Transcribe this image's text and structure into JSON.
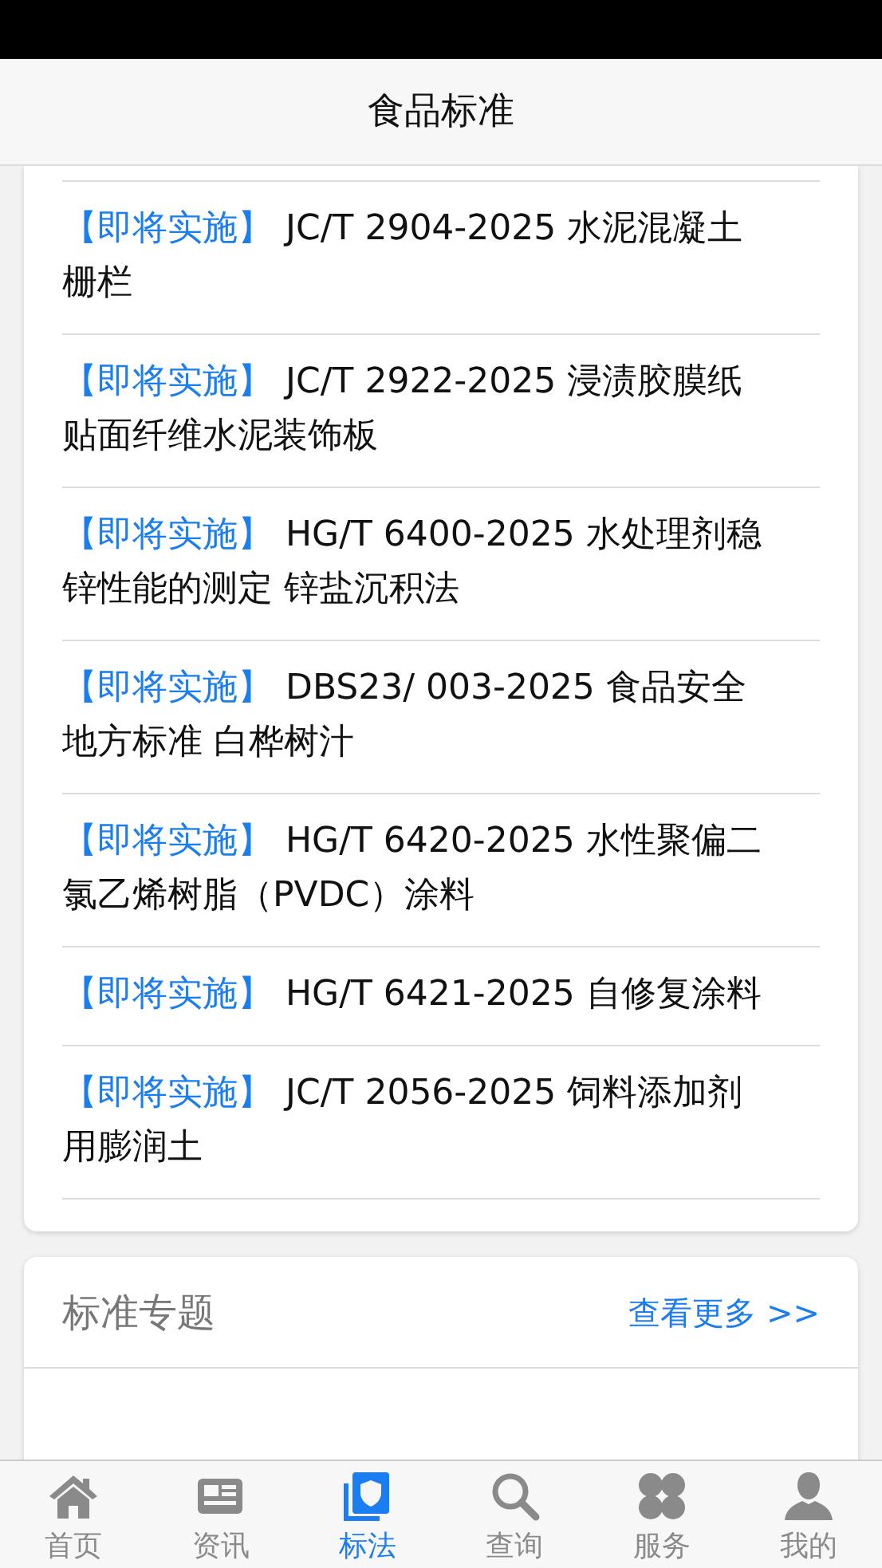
{
  "header": {
    "title": "食品标准"
  },
  "standards": [
    {
      "tag": "【即将实施】",
      "title": "JC/T 2904-2025 水泥混凝土栅栏"
    },
    {
      "tag": "【即将实施】",
      "title": "JC/T 2922-2025 浸渍胶膜纸贴面纤维水泥装饰板"
    },
    {
      "tag": "【即将实施】",
      "title": "HG/T 6400-2025 水处理剂稳锌性能的测定 锌盐沉积法"
    },
    {
      "tag": "【即将实施】",
      "title": "DBS23/ 003-2025 食品安全地方标准 白桦树汁"
    },
    {
      "tag": "【即将实施】",
      "title": "HG/T 6420-2025 水性聚偏二氯乙烯树脂（PVDC）涂料"
    },
    {
      "tag": "【即将实施】",
      "title": "HG/T 6421-2025 自修复涂料"
    },
    {
      "tag": "【即将实施】",
      "title": "JC/T 2056-2025 饲料添加剂用膨润土"
    }
  ],
  "topics": {
    "title": "标准专题",
    "more_link": "查看更多 >>"
  },
  "tab_bar": [
    {
      "kind": "home",
      "label": "首页",
      "selected": false
    },
    {
      "kind": "news",
      "label": "资讯",
      "selected": false
    },
    {
      "kind": "standards",
      "label": "标法",
      "selected": true
    },
    {
      "kind": "search",
      "label": "查询",
      "selected": false
    },
    {
      "kind": "services",
      "label": "服务",
      "selected": false
    },
    {
      "kind": "profile",
      "label": "我的",
      "selected": false
    }
  ]
}
